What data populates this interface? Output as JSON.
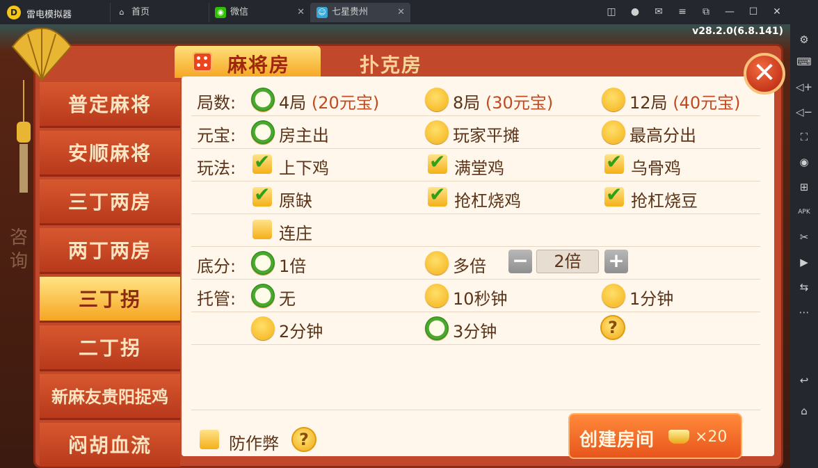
{
  "emulator": {
    "app_name": "雷电模拟器",
    "tabs": [
      {
        "label": "首页",
        "icon": "home-icon"
      },
      {
        "label": "微信",
        "icon": "wechat-icon"
      },
      {
        "label": "七星贵州",
        "icon": "game-icon"
      }
    ],
    "window_controls": [
      "gamepad-icon",
      "account-icon",
      "mail-icon",
      "menu-icon",
      "restore-icon",
      "minimize-icon",
      "maximize-icon",
      "close-icon"
    ],
    "sidebar_icons": [
      "settings-icon",
      "keyboard-icon",
      "volume-up-icon",
      "volume-down-icon",
      "screenshot-icon",
      "record-icon",
      "add-app-icon",
      "apk-icon",
      "scissors-icon",
      "video-icon",
      "sync-icon",
      "more-icon",
      "back-icon",
      "home-icon"
    ]
  },
  "game": {
    "version": "v28.2.0(6.8.141)",
    "bg_side_text": "咨\n询",
    "tabs": {
      "mahjong": "麻将房",
      "poker": "扑克房"
    },
    "menu": [
      {
        "label": "普定麻将"
      },
      {
        "label": "安顺麻将"
      },
      {
        "label": "三丁两房"
      },
      {
        "label": "两丁两房"
      },
      {
        "label": "三丁拐",
        "selected": true
      },
      {
        "label": "二丁拐"
      },
      {
        "label": "新麻友贵阳捉鸡"
      },
      {
        "label": "闷胡血流"
      }
    ],
    "rows": {
      "rounds": {
        "label": "局数:",
        "options": [
          {
            "text": "4局",
            "cost": "(20元宝)",
            "selected": true
          },
          {
            "text": "8局",
            "cost": "(30元宝)",
            "selected": false
          },
          {
            "text": "12局",
            "cost": "(40元宝)",
            "selected": false
          }
        ]
      },
      "ingot": {
        "label": "元宝:",
        "options": [
          {
            "text": "房主出",
            "selected": true
          },
          {
            "text": "玩家平摊",
            "selected": false
          },
          {
            "text": "最高分出",
            "selected": false
          }
        ]
      },
      "rules": {
        "label": "玩法:",
        "options": [
          {
            "text": "上下鸡",
            "checked": true
          },
          {
            "text": "满堂鸡",
            "checked": true
          },
          {
            "text": "乌骨鸡",
            "checked": true
          },
          {
            "text": "原缺",
            "checked": true
          },
          {
            "text": "抢杠烧鸡",
            "checked": true
          },
          {
            "text": "抢杠烧豆",
            "checked": true
          },
          {
            "text": "连庄",
            "checked": false
          }
        ]
      },
      "base_score": {
        "label": "底分:",
        "options": [
          {
            "text": "1倍",
            "selected": true
          },
          {
            "text": "多倍",
            "selected": false
          }
        ],
        "stepper": {
          "minus": "−",
          "value": "2倍",
          "plus": "+"
        }
      },
      "auto_play": {
        "label": "托管:",
        "options": [
          {
            "text": "无",
            "selected": true
          },
          {
            "text": "10秒钟",
            "selected": false
          },
          {
            "text": "1分钟",
            "selected": false
          },
          {
            "text": "2分钟",
            "selected": false
          },
          {
            "text": "3分钟",
            "selected": true
          }
        ],
        "help": "?"
      }
    },
    "anti_cheat": {
      "label": "防作弊",
      "checked": false,
      "help": "?"
    },
    "create": {
      "label": "创建房间",
      "qty": "×20"
    },
    "close_label": "✕"
  }
}
